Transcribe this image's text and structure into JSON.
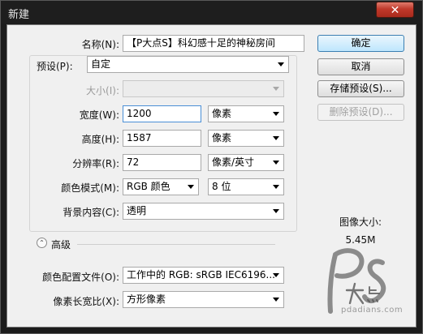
{
  "window": {
    "title": "新建",
    "close_glyph": "✕"
  },
  "form": {
    "name": {
      "label": "名称(N):",
      "value": "【P大点S】科幻感十足的神秘房间"
    },
    "preset": {
      "label": "预设(P):",
      "value": "自定"
    },
    "size": {
      "label": "大小(I):",
      "value": ""
    },
    "width": {
      "label": "宽度(W):",
      "value": "1200",
      "unit": "像素"
    },
    "height": {
      "label": "高度(H):",
      "value": "1587",
      "unit": "像素"
    },
    "resolution": {
      "label": "分辨率(R):",
      "value": "72",
      "unit": "像素/英寸"
    },
    "color_mode": {
      "label": "颜色模式(M):",
      "value": "RGB 颜色",
      "depth": "8 位"
    },
    "background": {
      "label": "背景内容(C):",
      "value": "透明"
    },
    "advanced": {
      "label": "高级",
      "icon": "double-chevron-up-icon",
      "glyph": "⌃"
    },
    "color_profile": {
      "label": "颜色配置文件(O):",
      "value": "工作中的 RGB: sRGB IEC6196..."
    },
    "pixel_aspect": {
      "label": "像素长宽比(X):",
      "value": "方形像素"
    }
  },
  "buttons": {
    "ok": "确定",
    "cancel": "取消",
    "save_preset": "存储预设(S)...",
    "delete_preset": "删除预设(D)..."
  },
  "image_info": {
    "label": "图像大小:",
    "value": "5.45M"
  },
  "watermark": {
    "logo_text": "PS大点",
    "site": "pdadians.com"
  },
  "colors": {
    "focus_border": "#4a8fd6",
    "close_button": "#c0392b",
    "default_button": "#bee6fd"
  }
}
